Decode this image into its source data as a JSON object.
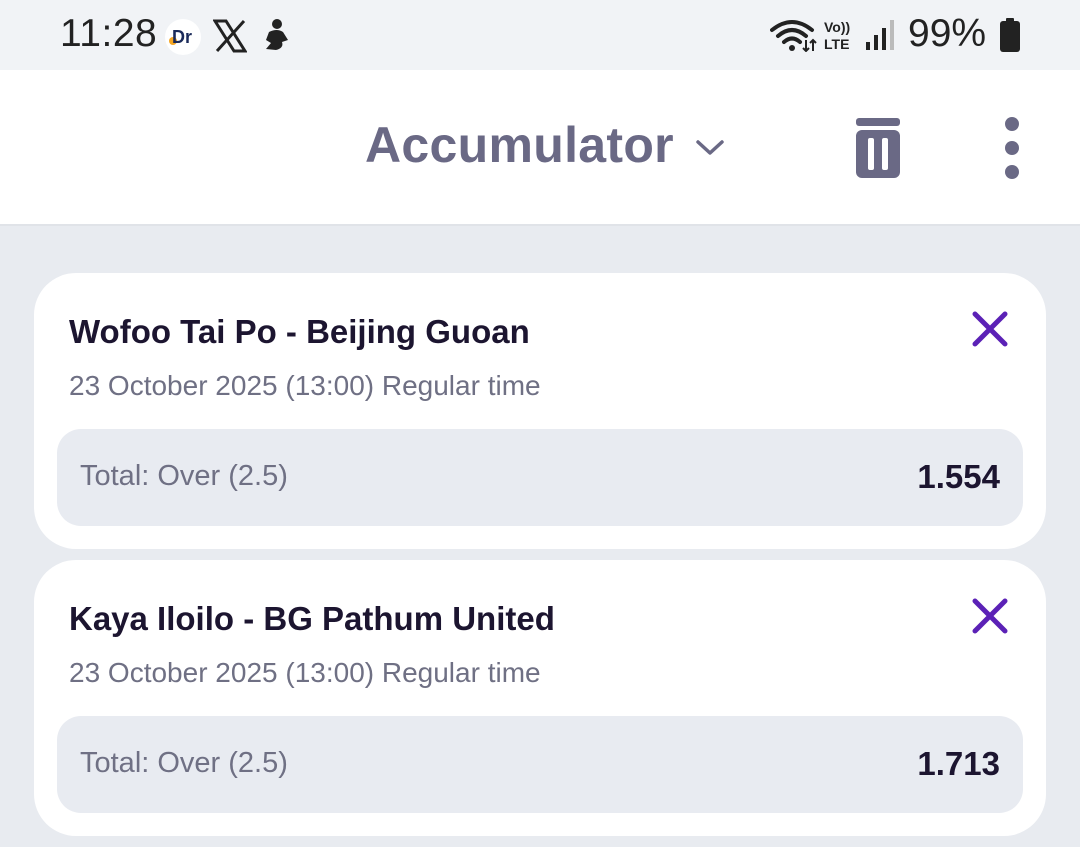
{
  "status_bar": {
    "time": "11:28",
    "battery": "99%",
    "app_icons": [
      "dr-app-icon",
      "x-app-icon",
      "figure-app-icon"
    ],
    "system_icons": [
      "wifi-icon",
      "volte-icon",
      "signal-icon",
      "battery-icon"
    ],
    "volte_top": "Vo))",
    "volte_bottom": "LTE",
    "dr_label": "Dr"
  },
  "header": {
    "title": "Accumulator",
    "icons": [
      "chevron-down-icon",
      "trash-icon",
      "more-vert-icon"
    ]
  },
  "bets": [
    {
      "match": "Wofoo Tai Po - Beijing Guoan",
      "date": "23 October 2025 (13:00) Regular time",
      "selection": "Total: Over (2.5)",
      "odds": "1.554"
    },
    {
      "match": "Kaya Iloilo - BG Pathum United",
      "date": "23 October 2025 (13:00) Regular time",
      "selection": "Total: Over (2.5)",
      "odds": "1.713"
    }
  ],
  "colors": {
    "accent": "#5b21b6",
    "title": "#6a6985",
    "text_dark": "#1c1530",
    "text_muted": "#6f7084",
    "background": "#e8ebf0"
  }
}
